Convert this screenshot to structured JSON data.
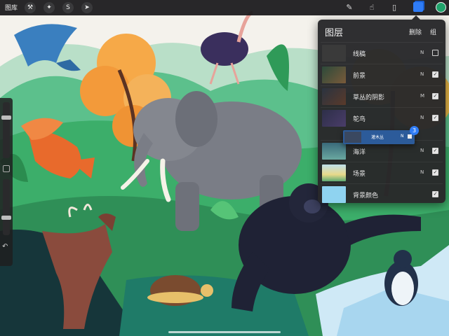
{
  "toolbar": {
    "gallery_label": "图库",
    "actions_icon": "wrench-icon",
    "adjustments_icon": "magic-wand-icon",
    "selection_icon": "selection-s-icon",
    "transform_icon": "arrow-cursor-icon",
    "brush_icon": "brush-icon",
    "smudge_icon": "smudge-icon",
    "eraser_icon": "eraser-icon",
    "layers_icon": "layers-icon",
    "active_color": "#1fa36b"
  },
  "sidebar": {
    "brush_size_level": 0.75,
    "opacity_level": 0.3,
    "undo_icon": "undo-icon"
  },
  "layers_panel": {
    "title": "图层",
    "delete_label": "删除",
    "group_label": "组",
    "layers": [
      {
        "name": "线稿",
        "blend": "N",
        "visible": false
      },
      {
        "name": "前景",
        "blend": "N",
        "visible": true
      },
      {
        "name": "草丛的阴影",
        "blend": "M",
        "visible": true
      },
      {
        "name": "鸵鸟",
        "blend": "N",
        "visible": true
      },
      {
        "name": "海洋",
        "blend": "N",
        "visible": true
      },
      {
        "name": "场景",
        "blend": "N",
        "visible": true
      },
      {
        "name": "背景颜色",
        "blend": "",
        "visible": true
      }
    ],
    "dragging_layer": {
      "name": "灌木丛",
      "blend": "N",
      "badge": "3"
    }
  },
  "colors": {
    "accent": "#2f7cf6",
    "panel_bg": "#28282a",
    "toolbar_bg": "#161618"
  }
}
